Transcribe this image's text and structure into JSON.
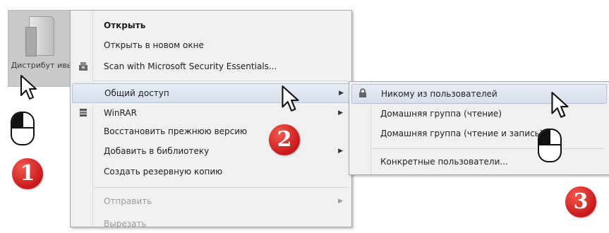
{
  "desktop": {
    "folder_label": "Дистрибут ивы"
  },
  "context_menu": {
    "items": [
      {
        "label": "Открыть",
        "bold": true
      },
      {
        "label": "Открыть в новом окне"
      },
      {
        "label": "Scan with Microsoft Security Essentials...",
        "icon": "security-essentials-icon"
      },
      {
        "label": "Общий доступ",
        "submenu": true,
        "highlighted": true
      },
      {
        "label": "WinRAR",
        "submenu": true,
        "icon": "winrar-icon"
      },
      {
        "label": "Восстановить прежнюю версию"
      },
      {
        "label": "Добавить в библиотеку",
        "submenu": true
      },
      {
        "label": "Создать резервную копию"
      },
      {
        "label": "Отправить",
        "submenu": true,
        "disabled": true
      },
      {
        "label": "Вырезать",
        "disabled": true
      }
    ],
    "arrow_glyph": "▶"
  },
  "submenu": {
    "items": [
      {
        "label": "Никому из пользователей",
        "icon": "lock-icon",
        "highlighted": true
      },
      {
        "label": "Домашняя группа (чтение)"
      },
      {
        "label": "Домашняя группа (чтение и запись)"
      },
      {
        "label": "Конкретные пользователи..."
      }
    ]
  },
  "steps": [
    "1",
    "2",
    "3"
  ],
  "colors": {
    "badge": "#d2202a",
    "highlight": "#dde5f0",
    "menu_bg": "#f0f0f0"
  }
}
